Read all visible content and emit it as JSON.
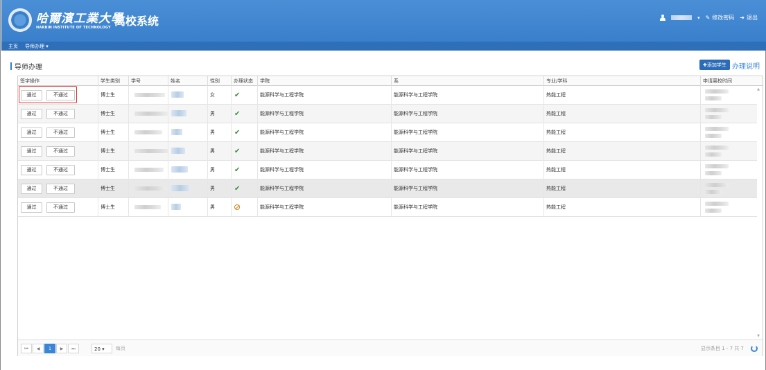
{
  "header": {
    "logo_cn": "哈爾濱工業大學",
    "logo_en": "HARBIN INSTITUTE OF TECHNOLOGY",
    "system_title": "离校系统",
    "change_password": "修改密码",
    "logout": "退出",
    "caret": "▾"
  },
  "menu": {
    "home": "主页",
    "advisor": "导师办理 ▾"
  },
  "section": {
    "title": "导师办理",
    "add_student": "✚添加学生",
    "help": "办理说明"
  },
  "table": {
    "columns": [
      "签字操作",
      "学生类别",
      "学号",
      "姓名",
      "性别",
      "办理状态",
      "学院",
      "系",
      "专业/学科",
      "申请离校时间"
    ],
    "approve_label": "通过",
    "reject_label": "不通过",
    "rows": [
      {
        "category": "博士生",
        "gender": "女",
        "status": "done",
        "college": "能源科学与工程学院",
        "dept": "能源科学与工程学院",
        "major": "热能工程"
      },
      {
        "category": "博士生",
        "gender": "男",
        "status": "done",
        "college": "能源科学与工程学院",
        "dept": "能源科学与工程学院",
        "major": "热能工程"
      },
      {
        "category": "博士生",
        "gender": "男",
        "status": "done",
        "college": "能源科学与工程学院",
        "dept": "能源科学与工程学院",
        "major": "热能工程"
      },
      {
        "category": "博士生",
        "gender": "男",
        "status": "done",
        "college": "能源科学与工程学院",
        "dept": "能源科学与工程学院",
        "major": "热能工程"
      },
      {
        "category": "博士生",
        "gender": "男",
        "status": "done",
        "college": "能源科学与工程学院",
        "dept": "能源科学与工程学院",
        "major": "热能工程"
      },
      {
        "category": "博士生",
        "gender": "男",
        "status": "done",
        "college": "能源科学与工程学院",
        "dept": "能源科学与工程学院",
        "major": "热能工程"
      },
      {
        "category": "博士生",
        "gender": "男",
        "status": "blocked",
        "college": "能源科学与工程学院",
        "dept": "能源科学与工程学院",
        "major": "热能工程"
      }
    ]
  },
  "pager": {
    "first": "⏮",
    "prev": "◀",
    "current": "1",
    "next": "▶",
    "last": "⏭",
    "page_size": "20 ▾",
    "page_size_label": "每页",
    "info": "显示条目 1 - 7 共 7"
  },
  "colors": {
    "header": "#3a7fcb",
    "menubar": "#2f6fb9",
    "accent": "#3a86d4",
    "check": "#3c8c3c",
    "highlight_box": "#d9342b"
  }
}
